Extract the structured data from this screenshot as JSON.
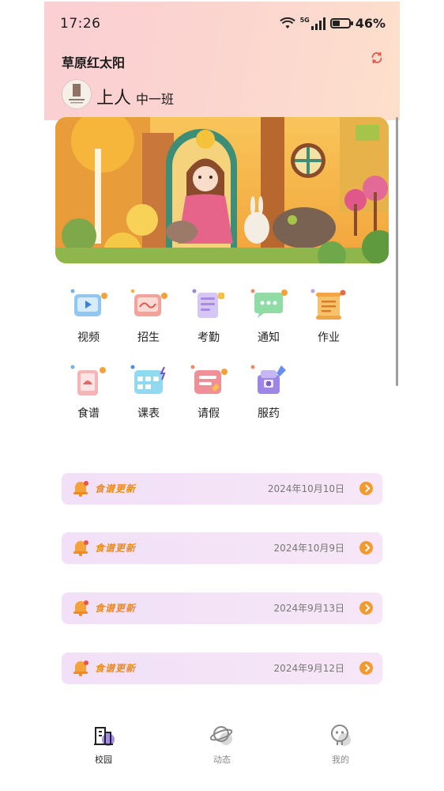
{
  "status_bar": {
    "time": "17:26",
    "network": "5G",
    "battery_text": "46%",
    "battery_level": 0.46
  },
  "header": {
    "school_name": "草原红太阳",
    "student_name": "上人",
    "class_name": "中一班"
  },
  "grid": [
    {
      "label": "视频",
      "icon": "video-icon"
    },
    {
      "label": "招生",
      "icon": "enrollment-icon"
    },
    {
      "label": "考勤",
      "icon": "attendance-icon"
    },
    {
      "label": "通知",
      "icon": "notice-icon"
    },
    {
      "label": "作业",
      "icon": "homework-icon"
    },
    {
      "label": "食谱",
      "icon": "recipe-icon"
    },
    {
      "label": "课表",
      "icon": "schedule-icon"
    },
    {
      "label": "请假",
      "icon": "leave-icon"
    },
    {
      "label": "服药",
      "icon": "medicine-icon"
    }
  ],
  "notices": [
    {
      "title": "食谱更新",
      "date": "2024年10月10日"
    },
    {
      "title": "食谱更新",
      "date": "2024年10月9日"
    },
    {
      "title": "食谱更新",
      "date": "2024年9月13日"
    },
    {
      "title": "食谱更新",
      "date": "2024年9月12日"
    }
  ],
  "tabs": [
    {
      "label": "校园",
      "icon": "campus-icon",
      "active": true
    },
    {
      "label": "动态",
      "icon": "planet-icon",
      "active": false
    },
    {
      "label": "我的",
      "icon": "profile-icon",
      "active": false
    }
  ],
  "colors": {
    "accent": "#f39a2e",
    "tab_active": "#222222",
    "tab_inactive": "#888888"
  }
}
